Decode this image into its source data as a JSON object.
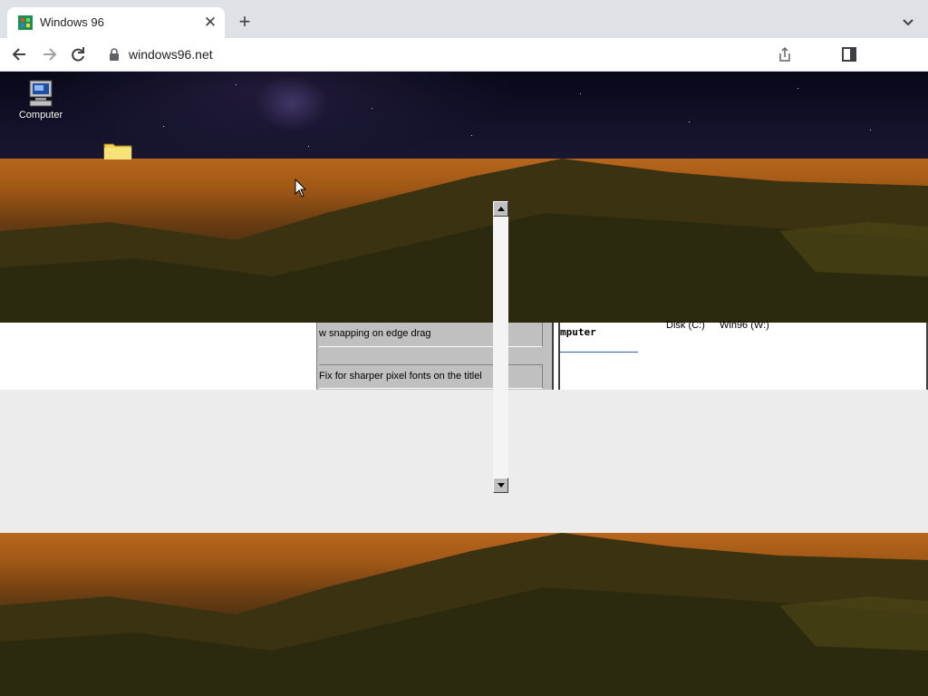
{
  "browser": {
    "tab_title": "Windows 96",
    "url": "windows96.net"
  },
  "desktop": {
    "icons": [
      {
        "label": "Computer",
        "icon": "computer-icon"
      },
      {
        "label": "",
        "icon": "folder-icon"
      }
    ]
  },
  "window_fragment": {
    "row1": "w snapping on edge drag",
    "row2": "Fix for sharper pixel fonts on the titlel"
  },
  "explorer_fragment": {
    "title": "mputer",
    "drives": [
      "Disk (C:)",
      "Win96 (W:)"
    ]
  },
  "colors": {
    "tab_strip": "#dee1e6",
    "win_face": "#c0c0c0",
    "link_underline": "#2b5ea8"
  }
}
